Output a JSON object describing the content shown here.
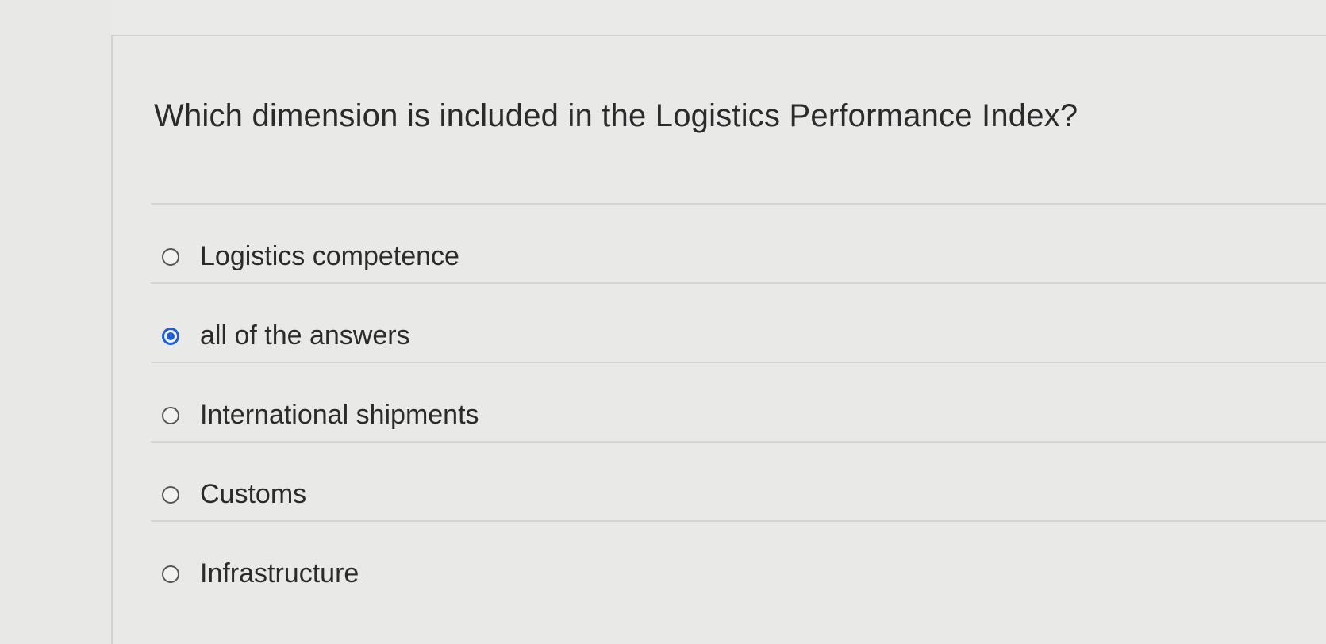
{
  "question": {
    "text": "Which dimension is included in the Logistics Performance Index?"
  },
  "answers": [
    {
      "label": "Logistics competence",
      "selected": false
    },
    {
      "label": "all of the answers",
      "selected": true
    },
    {
      "label": "International shipments",
      "selected": false
    },
    {
      "label": "Customs",
      "selected": false
    },
    {
      "label": "Infrastructure",
      "selected": false
    }
  ],
  "colors": {
    "selected_radio": "#1f5fd6",
    "background": "#e9e9e7",
    "text": "#2b2b2b"
  }
}
